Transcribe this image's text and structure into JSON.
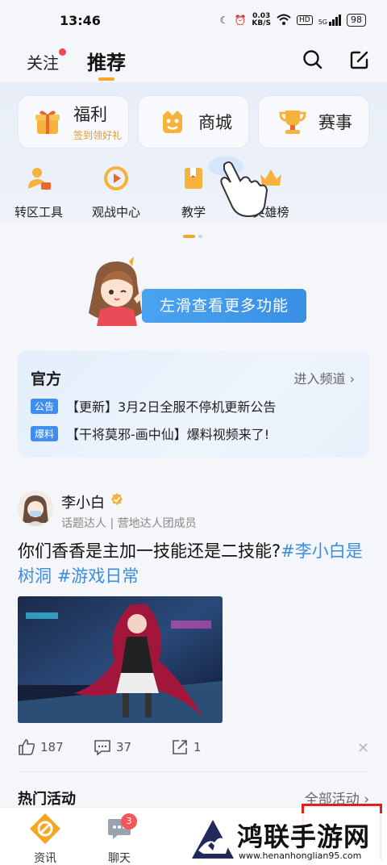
{
  "status_bar": {
    "time": "13:46",
    "net_speed_top": "0.03",
    "net_speed_bottom": "KB/S",
    "hd": "HD",
    "signal": "5G",
    "battery": "98"
  },
  "header": {
    "tab_follow": "关注",
    "tab_recommend": "推荐"
  },
  "feature_cards": [
    {
      "title": "福利",
      "subtitle": "签到领好礼"
    },
    {
      "title": "商城"
    },
    {
      "title": "赛事"
    }
  ],
  "functions": [
    {
      "label": "转区工具"
    },
    {
      "label": "观战中心"
    },
    {
      "label": "教学"
    },
    {
      "label": "英雄榜"
    }
  ],
  "swipe_hint": "左滑查看更多功能",
  "official": {
    "title": "官方",
    "enter": "进入频道",
    "items": [
      {
        "badge": "公告",
        "text": "【更新】3月2日全服不停机更新公告"
      },
      {
        "badge": "爆料",
        "text": "【干将莫邪-画中仙】爆料视频来了!"
      }
    ]
  },
  "post": {
    "author": "李小白",
    "tags": "话题达人 | 营地达人团成员",
    "text_plain": "你们香香是主加一技能还是二技能?",
    "hashtag1": "#李小白是树洞",
    "hashtag2": "#游戏日常",
    "likes": "187",
    "comments": "37",
    "shares": "1"
  },
  "hot": {
    "title": "热门活动",
    "all": "全部活动"
  },
  "bottom_nav": [
    {
      "label": "资讯"
    },
    {
      "label": "聊天",
      "badge": "3"
    }
  ],
  "watermark": {
    "name": "鸿联手游网",
    "url": "www.henanhonglian95.com"
  },
  "colors": {
    "accent": "#f5a623",
    "link": "#3b8ee2",
    "badge_blue": "#3e8ef0"
  }
}
